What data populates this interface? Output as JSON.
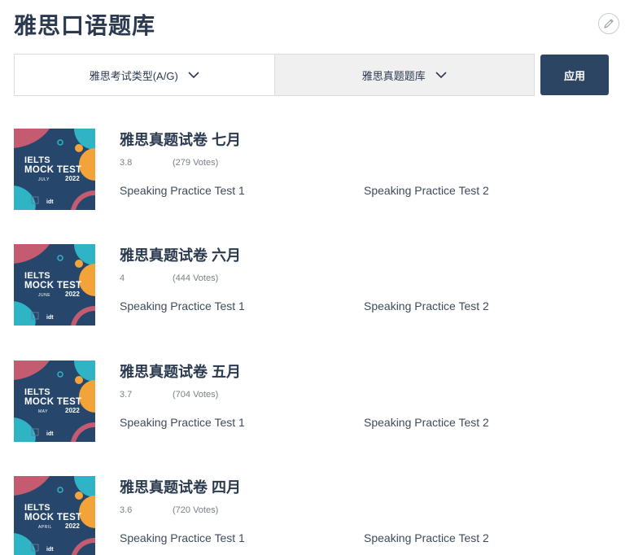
{
  "page": {
    "title": "雅思口语题库"
  },
  "filters": {
    "type_label": "雅思考试类型(A/G)",
    "bank_label": "雅思真题题库",
    "apply_label": "应用"
  },
  "thumbnail": {
    "line1": "IELTS",
    "line2": "MOCK TEST",
    "year": "2022"
  },
  "items": [
    {
      "title": "雅思真题试卷 七月",
      "month": "JULY",
      "rating": "3.8",
      "votes": "(279 Votes)",
      "test1": "Speaking Practice Test 1",
      "test2": "Speaking Practice Test 2"
    },
    {
      "title": "雅思真题试卷 六月",
      "month": "JUNE",
      "rating": "4",
      "votes": "(444 Votes)",
      "test1": "Speaking Practice Test 1",
      "test2": "Speaking Practice Test 2"
    },
    {
      "title": "雅思真题试卷 五月",
      "month": "MAY",
      "rating": "3.7",
      "votes": "(704 Votes)",
      "test1": "Speaking Practice Test 1",
      "test2": "Speaking Practice Test 2"
    },
    {
      "title": "雅思真题试卷 四月",
      "month": "APRIL",
      "rating": "3.6",
      "votes": "(720 Votes)",
      "test1": "Speaking Practice Test 1",
      "test2": "Speaking Practice Test 2"
    }
  ],
  "colors": {
    "accent": "#2b4563",
    "text": "#2b3a4e",
    "thumb_bg": "#26476b",
    "thumb_pink": "#c55b70",
    "thumb_orange": "#f2a33a",
    "thumb_teal": "#2fb4c6"
  },
  "icons": {
    "edit": "pencil-icon",
    "dropdown": "chevron-down-icon"
  }
}
